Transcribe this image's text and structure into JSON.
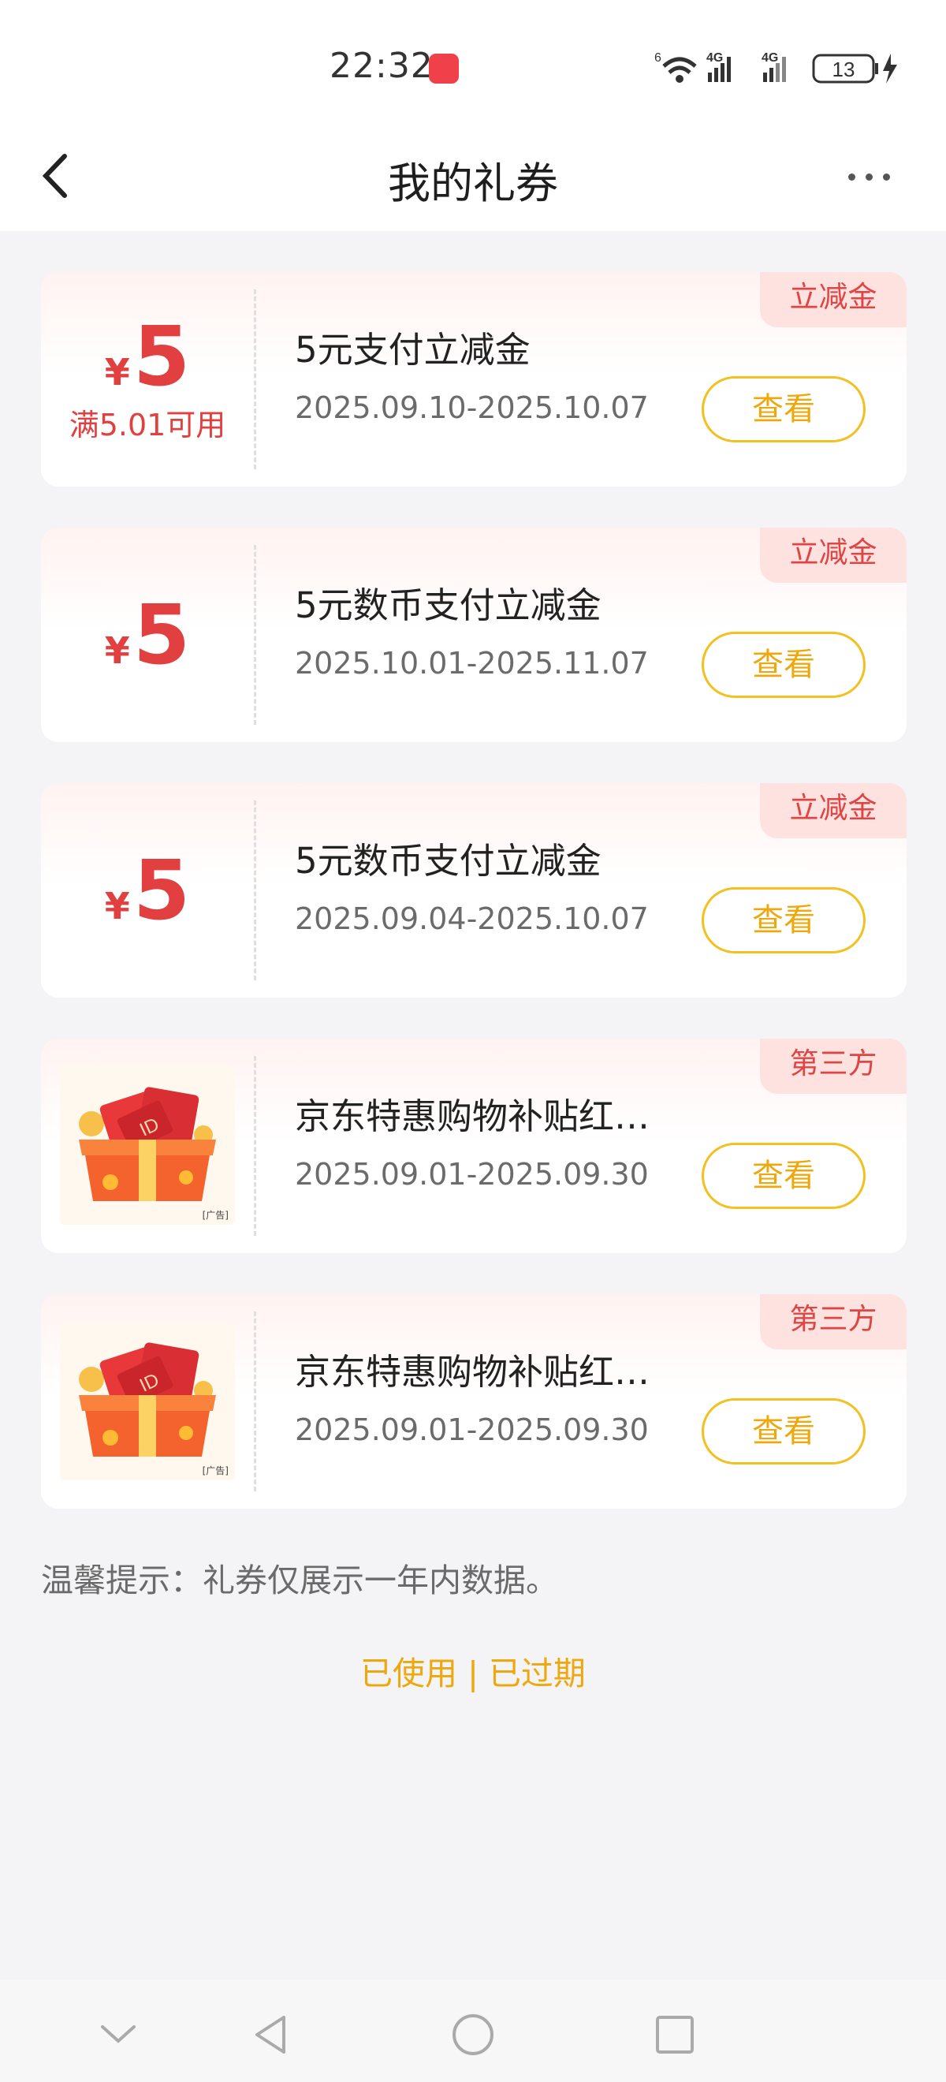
{
  "status_bar": {
    "time": "22:32",
    "signal_label_1": "4G",
    "signal_label_2": "4G",
    "wifi_label": "6",
    "battery": "13",
    "app_icon": "huawei-app-icon"
  },
  "header": {
    "title": "我的礼券",
    "back_icon": "chevron-left-icon",
    "more_icon": "more-dots-icon"
  },
  "coupons": [
    {
      "type": "amount",
      "currency": "¥",
      "amount": "5",
      "condition": "满5.01可用",
      "title": "5元支付立减金",
      "date_range": "2025.09.10-2025.10.07",
      "action": "查看",
      "tag": "立减金"
    },
    {
      "type": "amount",
      "currency": "¥",
      "amount": "5",
      "condition": "",
      "title": "5元数币支付立减金",
      "date_range": "2025.10.01-2025.11.07",
      "action": "查看",
      "tag": "立减金"
    },
    {
      "type": "amount",
      "currency": "¥",
      "amount": "5",
      "condition": "",
      "title": "5元数币支付立减金",
      "date_range": "2025.09.04-2025.10.07",
      "action": "查看",
      "tag": "立减金"
    },
    {
      "type": "image",
      "image_label": "ID",
      "image_ad_tag": "[广告]",
      "title": "京东特惠购物补贴红…",
      "date_range": "2025.09.01-2025.09.30",
      "action": "查看",
      "tag": "第三方"
    },
    {
      "type": "image",
      "image_label": "ID",
      "image_ad_tag": "[广告]",
      "title": "京东特惠购物补贴红…",
      "date_range": "2025.09.01-2025.09.30",
      "action": "查看",
      "tag": "第三方"
    }
  ],
  "tip": "温馨提示：礼券仅展示一年内数据。",
  "footer_links": "已使用 | 已过期",
  "colors": {
    "accent_red": "#e24040",
    "accent_gold": "#eea80e",
    "tag_bg": "#fde2e0"
  },
  "nav": {
    "icons": [
      "nav-collapse-icon",
      "nav-back-icon",
      "nav-home-icon",
      "nav-recents-icon"
    ]
  }
}
